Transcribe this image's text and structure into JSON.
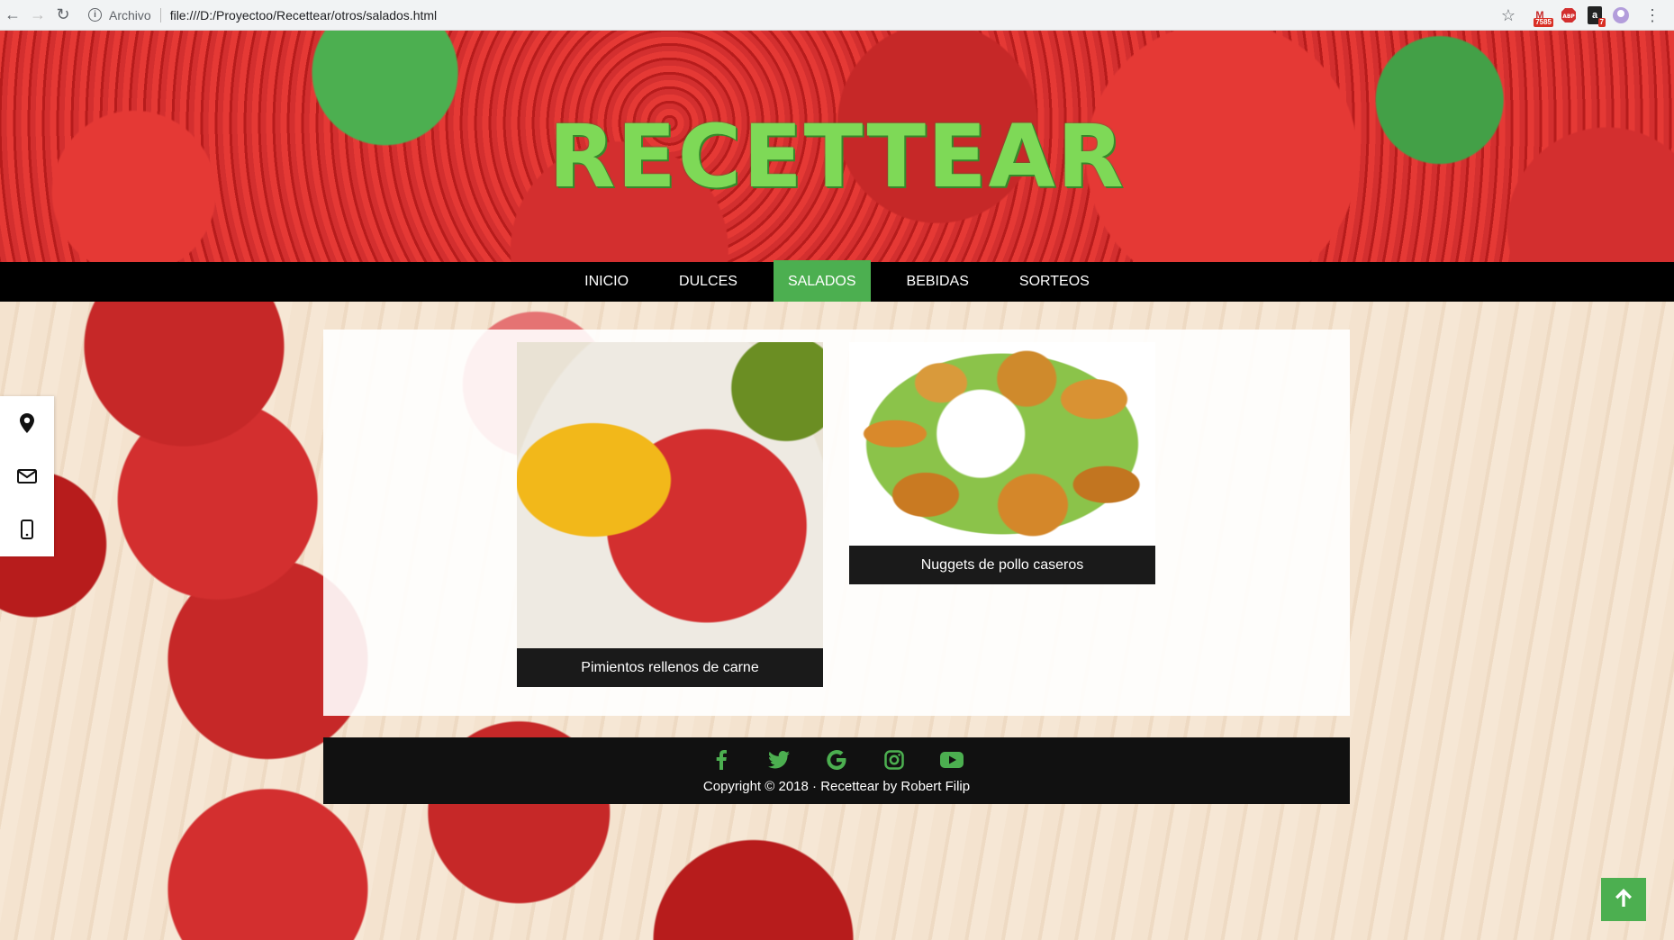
{
  "browser": {
    "security_label": "Archivo",
    "url": "file:///D:/Proyectoo/Recettear/otros/salados.html",
    "extensions": [
      {
        "name": "gmail-icon",
        "badge": "7585"
      },
      {
        "name": "adblock-icon",
        "badge": ""
      },
      {
        "name": "amazon-icon",
        "badge": "7"
      }
    ]
  },
  "header": {
    "title": "RECETTEAR"
  },
  "nav": {
    "items": [
      {
        "label": "INICIO"
      },
      {
        "label": "DULCES"
      },
      {
        "label": "SALADOS"
      },
      {
        "label": "BEBIDAS"
      },
      {
        "label": "SORTEOS"
      }
    ],
    "active": "SALADOS",
    "active_color": "#4caf50"
  },
  "sidebar": {
    "icons": [
      "map-marker-icon",
      "envelope-icon",
      "mobile-phone-icon"
    ]
  },
  "recipes": [
    {
      "title": "Pimientos rellenos de carne"
    },
    {
      "title": "Nuggets de pollo caseros"
    }
  ],
  "footer": {
    "social": [
      "facebook-icon",
      "twitter-icon",
      "google-icon",
      "instagram-icon",
      "youtube-icon"
    ],
    "social_color": "#4caf50",
    "copyright": "Copyright © 2018 · Recettear by Robert Filip"
  },
  "back_to_top": {
    "icon": "arrow-up-icon"
  }
}
